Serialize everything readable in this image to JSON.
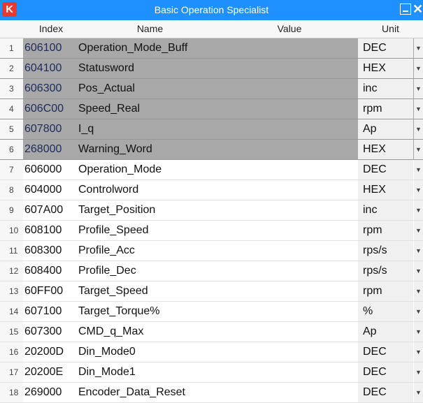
{
  "window": {
    "title": "Basic Operation Specialist",
    "logo_text": "K",
    "close_glyph": "✕"
  },
  "columns": [
    "Index",
    "Name",
    "Value",
    "Unit"
  ],
  "dropdown_glyph": "▼",
  "rows": [
    {
      "num": "1",
      "index": "606100",
      "name": "Operation_Mode_Buff",
      "value": "",
      "unit": "DEC",
      "selected": true
    },
    {
      "num": "2",
      "index": "604100",
      "name": "Statusword",
      "value": "",
      "unit": "HEX",
      "selected": true
    },
    {
      "num": "3",
      "index": "606300",
      "name": "Pos_Actual",
      "value": "",
      "unit": "inc",
      "selected": true
    },
    {
      "num": "4",
      "index": "606C00",
      "name": "Speed_Real",
      "value": "",
      "unit": "rpm",
      "selected": true
    },
    {
      "num": "5",
      "index": "607800",
      "name": "I_q",
      "value": "",
      "unit": "Ap",
      "selected": true
    },
    {
      "num": "6",
      "index": "268000",
      "name": "Warning_Word",
      "value": "",
      "unit": "HEX",
      "selected": true
    },
    {
      "num": "7",
      "index": "606000",
      "name": "Operation_Mode",
      "value": "",
      "unit": "DEC",
      "selected": false
    },
    {
      "num": "8",
      "index": "604000",
      "name": "Controlword",
      "value": "",
      "unit": "HEX",
      "selected": false
    },
    {
      "num": "9",
      "index": "607A00",
      "name": "Target_Position",
      "value": "",
      "unit": "inc",
      "selected": false
    },
    {
      "num": "10",
      "index": "608100",
      "name": "Profile_Speed",
      "value": "",
      "unit": "rpm",
      "selected": false
    },
    {
      "num": "11",
      "index": "608300",
      "name": "Profile_Acc",
      "value": "",
      "unit": "rps/s",
      "selected": false
    },
    {
      "num": "12",
      "index": "608400",
      "name": "Profile_Dec",
      "value": "",
      "unit": "rps/s",
      "selected": false
    },
    {
      "num": "13",
      "index": "60FF00",
      "name": "Target_Speed",
      "value": "",
      "unit": "rpm",
      "selected": false
    },
    {
      "num": "14",
      "index": "607100",
      "name": "Target_Torque%",
      "value": "",
      "unit": "%",
      "selected": false
    },
    {
      "num": "15",
      "index": "607300",
      "name": "CMD_q_Max",
      "value": "",
      "unit": "Ap",
      "selected": false
    },
    {
      "num": "16",
      "index": "20200D",
      "name": "Din_Mode0",
      "value": "",
      "unit": "DEC",
      "selected": false
    },
    {
      "num": "17",
      "index": "20200E",
      "name": "Din_Mode1",
      "value": "",
      "unit": "DEC",
      "selected": false
    },
    {
      "num": "18",
      "index": "269000",
      "name": "Encoder_Data_Reset",
      "value": "",
      "unit": "DEC",
      "selected": false
    }
  ]
}
